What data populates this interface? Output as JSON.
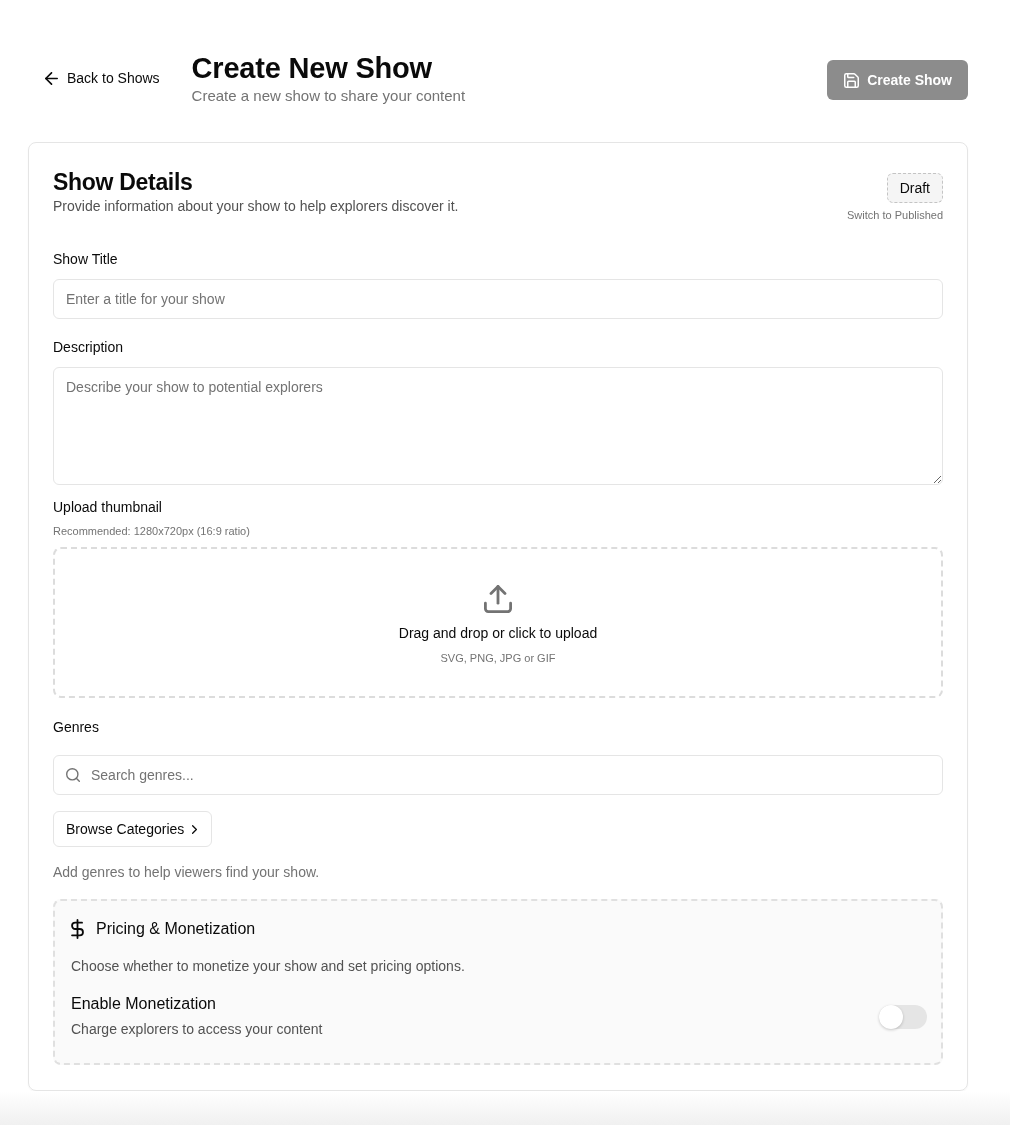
{
  "header": {
    "back_link": "Back to Shows",
    "title": "Create New Show",
    "subtitle": "Create a new show to share your content",
    "create_button": {
      "label": "Create Show",
      "disabled": true
    }
  },
  "details": {
    "title": "Show Details",
    "description": "Provide information about your show to help explorers discover it.",
    "status": {
      "label": "Draft",
      "action": "Switch to Published"
    }
  },
  "fields": [
    {
      "kind": "text",
      "label": "Show Title",
      "placeholder": "Enter a title for your show"
    },
    {
      "kind": "textarea",
      "label": "Description",
      "placeholder": "Describe your show to potential explorers"
    }
  ],
  "upload": {
    "label": "Upload thumbnail",
    "hint": "Recommended: 1280x720px (16:9 ratio)",
    "prompt": "Drag and drop or click to upload",
    "formats": "SVG, PNG, JPG or GIF"
  },
  "genres": {
    "label": "Genres",
    "placeholder": "Search genres...",
    "browse_button": "Browse Categories",
    "help": "Add genres to help viewers find your show."
  },
  "pricing": {
    "title": "Pricing & Monetization",
    "description": "Choose whether to monetize your show and set pricing options.",
    "toggle": {
      "label": "Enable Monetization",
      "description": "Charge explorers to access your content",
      "on": false
    }
  }
}
